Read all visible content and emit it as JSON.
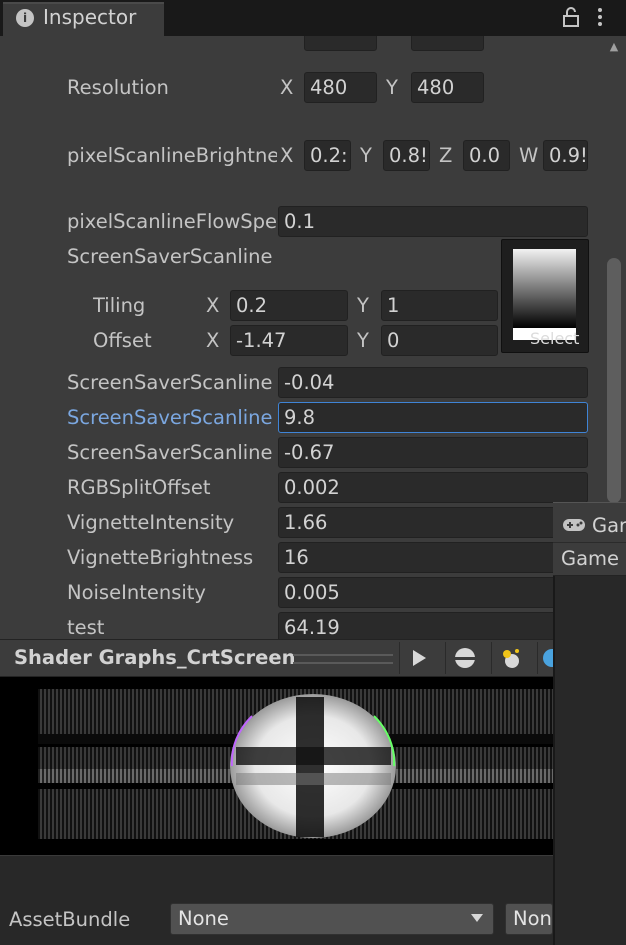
{
  "tab": {
    "title": "Inspector"
  },
  "properties": {
    "resolution": {
      "label": "Resolution",
      "x_axis": "X",
      "x": "480",
      "y_axis": "Y",
      "y": "480"
    },
    "brightness": {
      "label": "pixelScanlineBrightne",
      "x_axis": "X",
      "x": "0.2:",
      "y_axis": "Y",
      "y": "0.8!",
      "z_axis": "Z",
      "z": "0.0",
      "w_axis": "W",
      "w": "0.9!"
    },
    "flow_speed": {
      "label": "pixelScanlineFlowSpe",
      "value": "0.1"
    },
    "screensaver_tex": {
      "label": "ScreenSaverScanline",
      "tiling_label": "Tiling",
      "tiling_x_axis": "X",
      "tiling_x": "0.2",
      "tiling_y_axis": "Y",
      "tiling_y": "1",
      "offset_label": "Offset",
      "offset_x_axis": "X",
      "offset_x": "-1.47",
      "offset_y_axis": "Y",
      "offset_y": "0",
      "select_label": "Select"
    },
    "ss1": {
      "label": "ScreenSaverScanline",
      "value": "-0.04"
    },
    "ss2": {
      "label": "ScreenSaverScanline",
      "value": "9.8"
    },
    "ss3": {
      "label": "ScreenSaverScanline",
      "value": "-0.67"
    },
    "rgb_split": {
      "label": "RGBSplitOffset",
      "value": "0.002"
    },
    "vig_int": {
      "label": "VignetteIntensity",
      "value": "1.66"
    },
    "vig_bright": {
      "label": "VignetteBrightness",
      "value": "16"
    },
    "noise": {
      "label": "NoiseIntensity",
      "value": "0.005"
    },
    "test": {
      "label": "test",
      "value": "64.19"
    }
  },
  "game_window": {
    "tab_label": "Gar",
    "toolbar_label": "Game"
  },
  "preview": {
    "title": "Shader Graphs_CrtScreen",
    "buttons": [
      "play-icon",
      "sphere-icon",
      "lighting-icon",
      "material-sphere-icon"
    ]
  },
  "asset_bundle": {
    "label": "AssetBundle",
    "bundle_value": "None",
    "variant_value": "Non"
  },
  "colors": {
    "accent": "#3f84d6",
    "selected_label": "#7ba7e0",
    "panel": "#3c3c3c",
    "field": "#2a2a2a"
  }
}
